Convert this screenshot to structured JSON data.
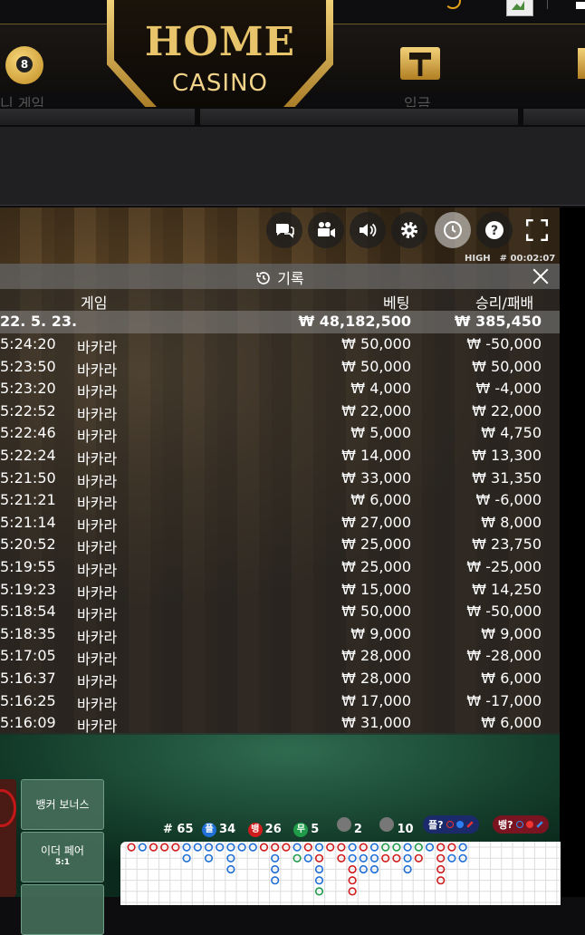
{
  "site": {
    "logo_line1": "HOME",
    "logo_line2": "CASINO",
    "nav_mini_game": "니 게임",
    "nav_deposit": "입금",
    "eight_ball_label": "8",
    "accent_gold": "#e8c46a"
  },
  "player": {
    "limits": {
      "level": "HIGH",
      "round_id": "# 00:02:07"
    },
    "controls": [
      "chat-icon",
      "camera-icon",
      "sound-icon",
      "settings-icon",
      "history-icon",
      "help-icon",
      "fullscreen-icon"
    ]
  },
  "history": {
    "title": "기록",
    "columns": {
      "game": "게임",
      "bet": "베팅",
      "result": "승리/패배"
    },
    "summary": {
      "date": "22. 5. 23.",
      "bet": "₩ 48,182,500",
      "result": "₩ 385,450"
    },
    "rows": [
      {
        "time": "5:24:20",
        "game": "바카라",
        "bet": "₩ 50,000",
        "result": "₩ -50,000"
      },
      {
        "time": "5:23:50",
        "game": "바카라",
        "bet": "₩ 50,000",
        "result": "₩ 50,000"
      },
      {
        "time": "5:23:20",
        "game": "바카라",
        "bet": "₩ 4,000",
        "result": "₩ -4,000"
      },
      {
        "time": "5:22:52",
        "game": "바카라",
        "bet": "₩ 22,000",
        "result": "₩ 22,000"
      },
      {
        "time": "5:22:46",
        "game": "바카라",
        "bet": "₩ 5,000",
        "result": "₩ 4,750"
      },
      {
        "time": "5:22:24",
        "game": "바카라",
        "bet": "₩ 14,000",
        "result": "₩ 13,300"
      },
      {
        "time": "5:21:50",
        "game": "바카라",
        "bet": "₩ 33,000",
        "result": "₩ 31,350"
      },
      {
        "time": "5:21:21",
        "game": "바카라",
        "bet": "₩ 6,000",
        "result": "₩ -6,000"
      },
      {
        "time": "5:21:14",
        "game": "바카라",
        "bet": "₩ 27,000",
        "result": "₩ 8,000"
      },
      {
        "time": "5:20:52",
        "game": "바카라",
        "bet": "₩ 25,000",
        "result": "₩ 23,750"
      },
      {
        "time": "5:19:55",
        "game": "바카라",
        "bet": "₩ 25,000",
        "result": "₩ -25,000"
      },
      {
        "time": "5:19:23",
        "game": "바카라",
        "bet": "₩ 15,000",
        "result": "₩ 14,250"
      },
      {
        "time": "5:18:54",
        "game": "바카라",
        "bet": "₩ 50,000",
        "result": "₩ -50,000"
      },
      {
        "time": "5:18:35",
        "game": "바카라",
        "bet": "₩ 9,000",
        "result": "₩ 9,000"
      },
      {
        "time": "5:17:05",
        "game": "바카라",
        "bet": "₩ 28,000",
        "result": "₩ -28,000"
      },
      {
        "time": "5:16:37",
        "game": "바카라",
        "bet": "₩ 28,000",
        "result": "₩ 6,000"
      },
      {
        "time": "5:16:25",
        "game": "바카라",
        "bet": "₩ 17,000",
        "result": "₩ -17,000"
      },
      {
        "time": "5:16:09",
        "game": "바카라",
        "bet": "₩ 31,000",
        "result": "₩ 6,000"
      }
    ]
  },
  "bets": {
    "banker_bonus": "뱅커 보너스",
    "either_pair": "이더 페어",
    "either_pair_odds": "5:1"
  },
  "stats": {
    "round_count": "# 65",
    "player_label": "플",
    "player_count": "34",
    "banker_label": "뱅",
    "banker_count": "26",
    "tie_label": "무",
    "tie_count": "5",
    "player_pair_count": "2",
    "banker_pair_count": "10",
    "player_predict": "플?",
    "banker_predict": "뱅?",
    "colors": {
      "player": "#1f6fd6",
      "banker": "#d01c1c",
      "tie": "#1f9b4a"
    }
  }
}
